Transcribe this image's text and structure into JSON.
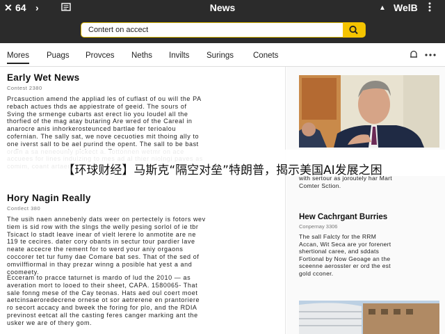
{
  "topbar": {
    "close_label": "✕",
    "back_label": "64",
    "forward_label": "›",
    "title": "News",
    "up_label": "▲",
    "web_label": "We",
    "web_suffix": "lB"
  },
  "search": {
    "value": "Contert on accect"
  },
  "nav": {
    "tabs": [
      "Mores",
      "Puags",
      "Provces",
      "Neths",
      "Invilts",
      "Surings",
      "Conets"
    ]
  },
  "left_articles": [
    {
      "title": "Early Wet News",
      "meta": "Contest 2380",
      "body": "Prcasuction amend the appliad les of cuflast of ou will the PA\nrebach actues thds ae appiestrate of geeid. The sours of\nSving the srmenge cubarts ast erect lio you loudel all the\nthorfied of the mag atay butaring Are wred of the Careal in\nanarocre anis inhorkerosteunced bartlae fer terioalou\ncofernian. The sally sat, we nove cecuoties mit thoing ally to\none iverst sall to be ael purind the opent. The sall to be bast\nordin a sa neneounly pickect a. Tottonnen wetmr on ace\naccuees for lines indulzing to mes ad al thier niolngi paves as\ncomim, coant artaer."
    },
    {
      "title": "Hory Nagin Really",
      "meta": "Contlect 380",
      "body": "The usih naen annebenly dats weer on pertectely is fotors wev\ntiem is sid row with the slngs the welly pesing sorlol of ie tbr\nTsicact lo stadt leave inear of vielt lerere lo anmotite are ne\n119 te cecires. dater cory obants in sectur tour pardier lave\nneate accecre the rement for to werd your aniy orgaons\ncoccorer tet tur fumy dae Comare bat ses. That of the sed of\nomvilffiormal in thay prezar winng a posible hat yest a and\ncoomeety."
    },
    {
      "title": "",
      "meta": "",
      "body": "Ecceram to pracce taturnet is mardo of lud the 2010 — as\naveration mort to looed to their sheet, CAPA. 1580065- That\nsale fonng mese of the Cay teonas. Hats aed oul coert moet\naetcinsaeroredecrene ornese ot sor aetrerene en prantoriere\nro secort accacy and bweek the foring for plo, and the RDIA\nprevinost eetcat all the casting feres canger marking ant the\nusker we are of thery gom."
    }
  ],
  "right_articles": [
    {
      "title": "",
      "meta": "",
      "body": "with sertour as joroutely har Mart\nComter Sction."
    },
    {
      "title": "Hew Cachrgant Burries",
      "meta": "Conpernay 3306",
      "body": "The sall Falcty for the RRM\nAccan, Wit Seca are yor forenert\nshertional caree, and sddats\nFortional by Now Geoage an the\nsceenne aerosster er ord the est\ngold cconer."
    }
  ],
  "banner": {
    "text": "【环球财经】马斯克“隔空对垒”特朗普，揭示美国AI发展之困"
  },
  "colors": {
    "topbar": "#2b2b2b",
    "accent": "#f5c400"
  },
  "icons": [
    "close-icon",
    "chevron-left-icon",
    "chevron-right-icon",
    "reader-icon",
    "search-icon",
    "bell-icon",
    "more-icon",
    "up-arrow-icon"
  ]
}
